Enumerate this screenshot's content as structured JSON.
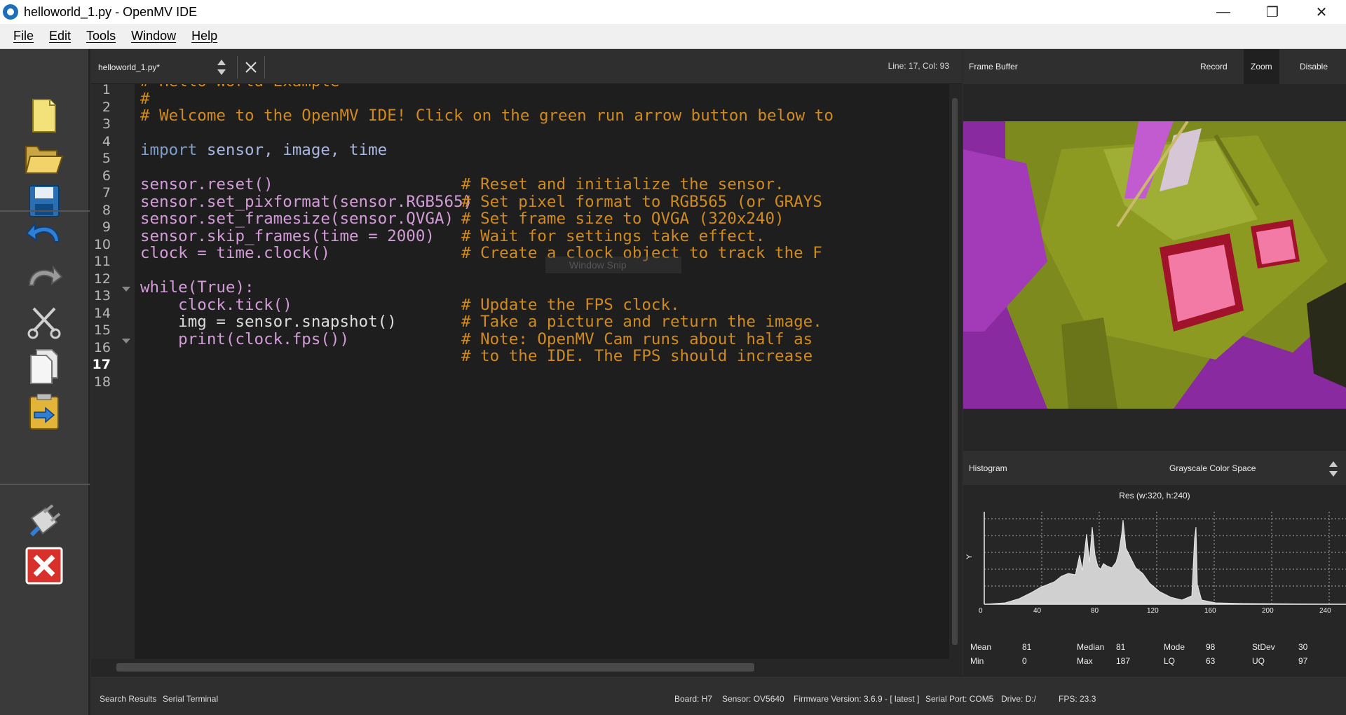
{
  "window": {
    "title": "helloworld_1.py - OpenMV IDE"
  },
  "menu": [
    "File",
    "Edit",
    "Tools",
    "Window",
    "Help"
  ],
  "editor": {
    "file_tab": "helloworld_1.py*",
    "cursor_pos": "Line: 17, Col: 93",
    "line_numbers": [
      "1",
      "2",
      "3",
      "4",
      "5",
      "6",
      "7",
      "8",
      "9",
      "10",
      "11",
      "12",
      "13",
      "14",
      "15",
      "16",
      "17",
      "18"
    ],
    "watermark": "Window Snip"
  },
  "frame_buffer": {
    "title": "Frame Buffer",
    "record_label": "Record",
    "zoom_label": "Zoom",
    "disable_label": "Disable"
  },
  "histogram": {
    "title": "Histogram",
    "color_space": "Grayscale Color Space",
    "resolution": "Res (w:320, h:240)",
    "y_axis_label": "Y",
    "x_ticks": [
      "0",
      "40",
      "80",
      "120",
      "160",
      "200",
      "240"
    ],
    "stats": {
      "mean_label": "Mean",
      "mean": "81",
      "median_label": "Median",
      "median": "81",
      "mode_label": "Mode",
      "mode": "98",
      "stdev_label": "StDev",
      "stdev": "30",
      "min_label": "Min",
      "min": "0",
      "max_label": "Max",
      "max": "187",
      "lq_label": "LQ",
      "lq": "63",
      "uq_label": "UQ",
      "uq": "97"
    }
  },
  "status": {
    "search_results": "Search Results",
    "serial_terminal": "Serial Terminal",
    "board": "Board: H7",
    "sensor": "Sensor: OV5640",
    "firmware": "Firmware Version: 3.6.9 - [ latest ]",
    "serial_port": "Serial Port: COM5",
    "drive": "Drive: D:/",
    "fps": "FPS: 23.3"
  },
  "code_lines": {
    "l1": "# Hello World Example",
    "l2": "#",
    "l3": "# Welcome to the OpenMV IDE! Click on the green run arrow button below to",
    "l5a": "import",
    "l5b": " sensor, image, time",
    "l7a": "sensor.reset()",
    "l7b": "# Reset and initialize the sensor.",
    "l8a": "sensor.set_pixformat(sensor.RGB565)",
    "l8b": "# Set pixel format to RGB565 (or GRAYS",
    "l9a": "sensor.set_framesize(sensor.QVGA)",
    "l9b": "# Set frame size to QVGA (320x240)",
    "l10a": "sensor.skip_frames(time = 2000)",
    "l10b": "# Wait for settings take effect.",
    "l11a": "clock = time.clock()",
    "l11b": "# Create a clock object to track the F",
    "l13": "while(True):",
    "l14a": "    clock.tick()",
    "l14b": "# Update the FPS clock.",
    "l15a": "    img = sensor.snapshot()",
    "l15b": "# Take a picture and return the image.",
    "l16a": "    print(clock.fps())",
    "l16b": "# Note: OpenMV Cam runs about half as",
    "l17b": "# to the IDE. The FPS should increase"
  }
}
